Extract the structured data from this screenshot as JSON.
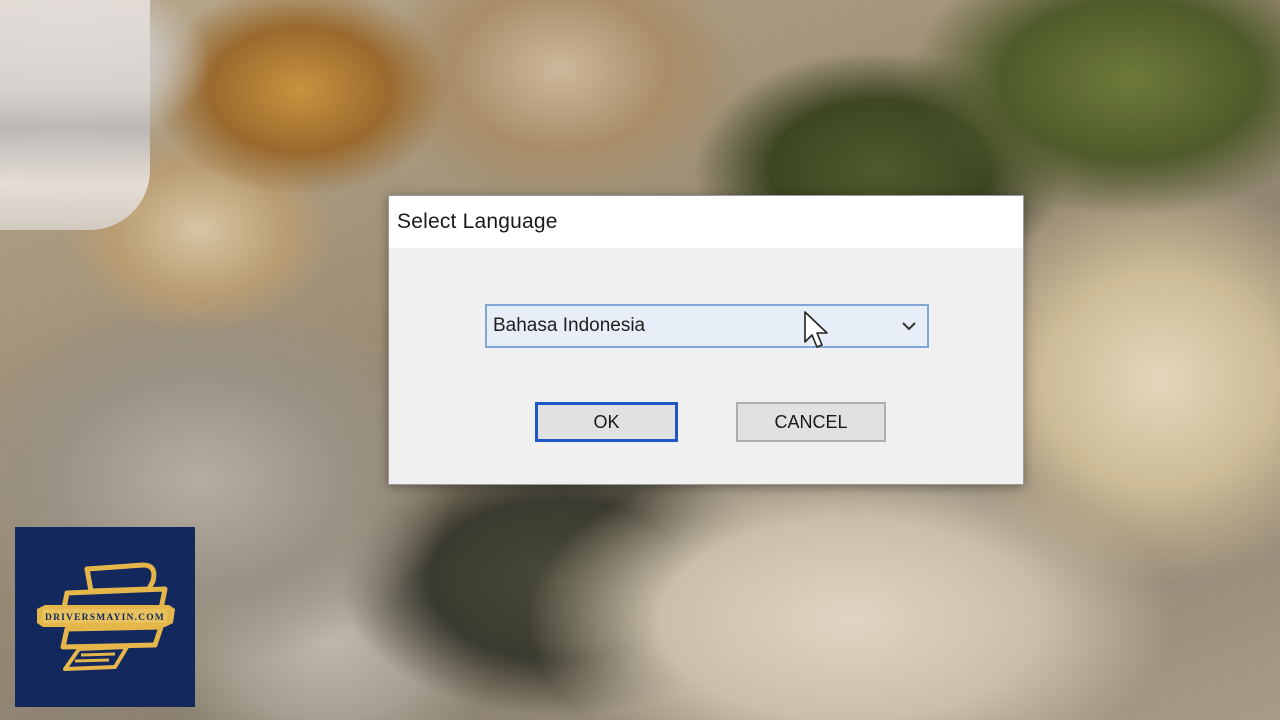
{
  "dialog": {
    "title": "Select Language",
    "language_select": {
      "selected_value": "Bahasa Indonesia"
    },
    "ok_label": "OK",
    "cancel_label": "CANCEL"
  },
  "watermark": {
    "text": "DRIVERSMAYIN.COM"
  },
  "colors": {
    "ok_button_border": "#1f57c8",
    "select_border": "#7fa6d6",
    "logo_background": "#13295e",
    "logo_gold": "#e5b64a"
  }
}
